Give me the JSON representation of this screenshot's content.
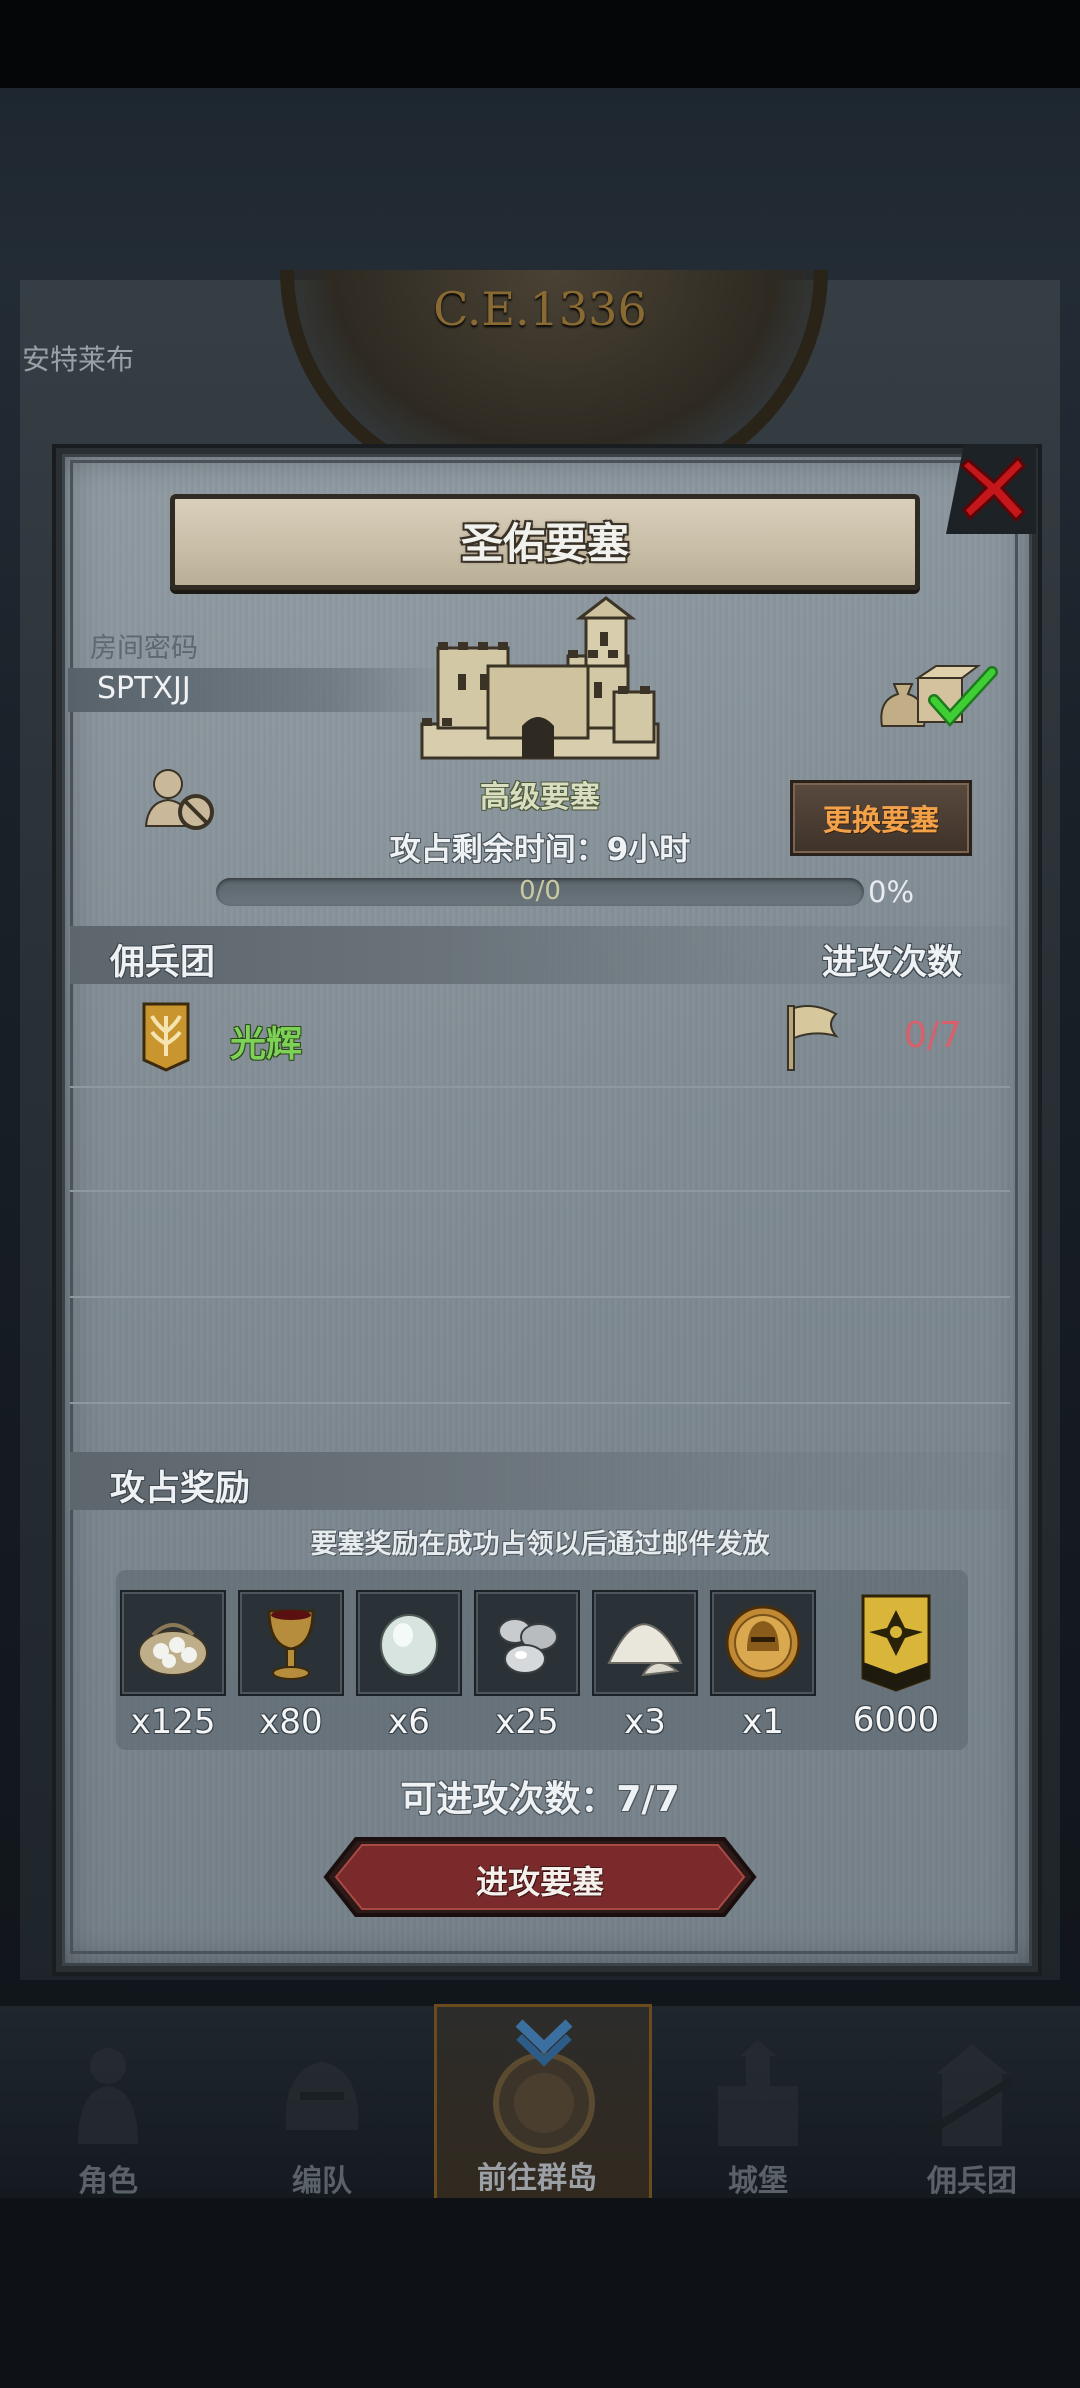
{
  "background": {
    "era": "C.E.1336",
    "side_label": "安特莱布"
  },
  "dialog": {
    "title": "圣佑要塞",
    "room_code_label": "房间密码",
    "room_code": "SPTXJJ",
    "fortress_level": "高级要塞",
    "change_button": "更换要塞",
    "remaining_time": "攻占剩余时间：9小时",
    "progress": {
      "count": "0/0",
      "percent": "0%",
      "fraction": 0
    },
    "mercenary_header": "佣兵团",
    "attack_count_header": "进攻次数",
    "guild": {
      "name": "光辉",
      "attacks": "0/7"
    },
    "reward_header": "攻占奖励",
    "reward_note": "要塞奖励在成功占领以后通过邮件发放",
    "rewards": [
      {
        "icon": "sack-icon",
        "qty": "x125"
      },
      {
        "icon": "goblet-icon",
        "qty": "x80"
      },
      {
        "icon": "gem-icon",
        "qty": "x6"
      },
      {
        "icon": "silver-ore-icon",
        "qty": "x25"
      },
      {
        "icon": "salt-pile-icon",
        "qty": "x3"
      },
      {
        "icon": "helmet-coin-icon",
        "qty": "x1"
      },
      {
        "icon": "banner-emblem-icon",
        "qty": "6000"
      }
    ],
    "attacks_available": "可进攻次数：7/7",
    "attack_button": "进攻要塞"
  },
  "nav": {
    "items": [
      {
        "label": "角色",
        "icon": "knight-icon"
      },
      {
        "label": "编队",
        "icon": "helmet-icon"
      },
      {
        "label": "前往群岛",
        "icon": "compass-icon",
        "active": true
      },
      {
        "label": "城堡",
        "icon": "castle-icon"
      },
      {
        "label": "佣兵团",
        "icon": "mercenary-icon"
      }
    ]
  },
  "colors": {
    "guild_name": "#7ed157",
    "attacks_used": "#d9606a",
    "change_button_text": "#f4a24a",
    "attack_button": "#7a2a2a"
  }
}
